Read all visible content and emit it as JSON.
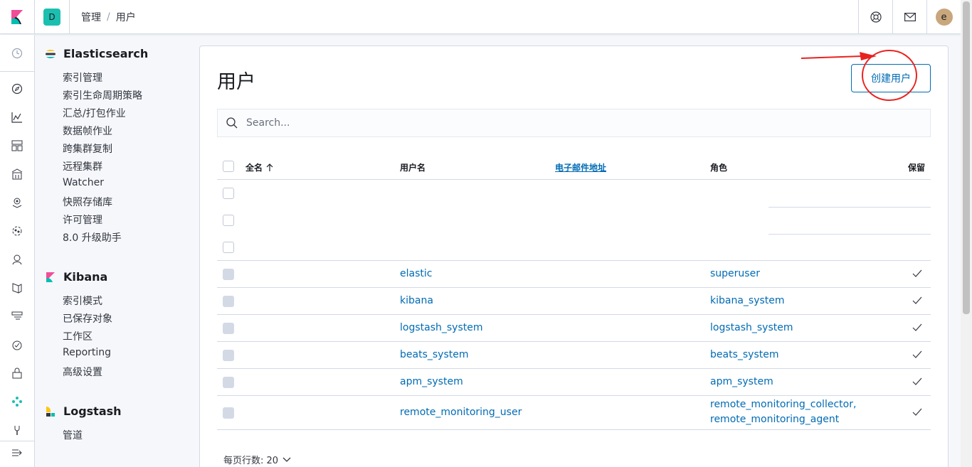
{
  "header": {
    "space_initial": "D",
    "breadcrumbs": [
      "管理",
      "用户"
    ],
    "breadcrumb_sep": "/",
    "user_initial": "e"
  },
  "nav_icons": [
    "clock-icon",
    "compass-icon",
    "visualize-icon",
    "dashboard-icon",
    "canvas-icon",
    "maps-icon",
    "ml-icon",
    "apm-icon",
    "infra-icon",
    "logs-icon",
    "uptime-icon",
    "security-icon",
    "graph-icon",
    "dev-tools-icon",
    "collapse-icon"
  ],
  "sidebar": {
    "groups": [
      {
        "title": "Elasticsearch",
        "items": [
          "索引管理",
          "索引生命周期策略",
          "汇总/打包作业",
          "数据帧作业",
          "跨集群复制",
          "远程集群",
          "Watcher",
          "快照存储库",
          "许可管理",
          "8.0 升级助手"
        ]
      },
      {
        "title": "Kibana",
        "items": [
          "索引模式",
          "已保存对象",
          "工作区",
          "Reporting",
          "高级设置"
        ]
      },
      {
        "title": "Logstash",
        "items": [
          "管道"
        ]
      }
    ]
  },
  "main": {
    "title": "用户",
    "create_button": "创建用户",
    "search_placeholder": "Search...",
    "columns": {
      "full_name": "全名",
      "username": "用户名",
      "email": "电子邮件地址",
      "roles": "角色",
      "reserved": "保留"
    },
    "rows": [
      {
        "username": "elastic",
        "roles": [
          "superuser"
        ]
      },
      {
        "username": "kibana",
        "roles": [
          "kibana_system"
        ]
      },
      {
        "username": "logstash_system",
        "roles": [
          "logstash_system"
        ]
      },
      {
        "username": "beats_system",
        "roles": [
          "beats_system"
        ]
      },
      {
        "username": "apm_system",
        "roles": [
          "apm_system"
        ]
      },
      {
        "username": "remote_monitoring_user",
        "roles": [
          "remote_monitoring_collector,",
          "remote_monitoring_agent"
        ]
      }
    ],
    "rows_per_page": "每页行数: 20"
  },
  "colors": {
    "link": "#006bb4",
    "accent": "#1bbfb0",
    "annotation": "#e8231f"
  }
}
